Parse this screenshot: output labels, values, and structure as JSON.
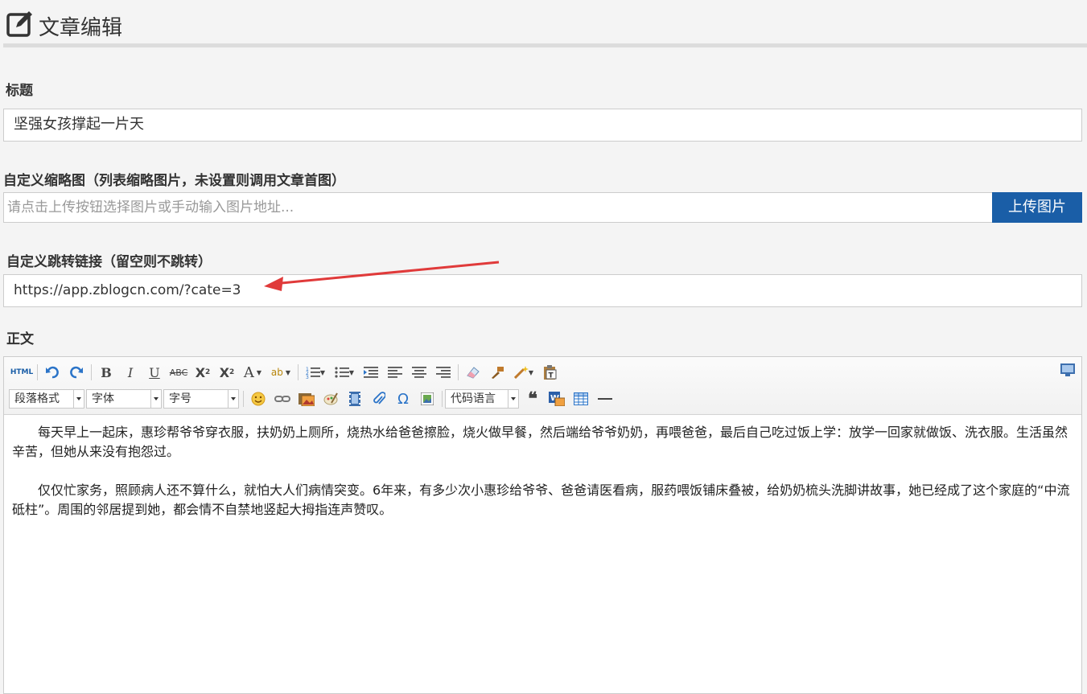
{
  "header": {
    "title": "文章编辑"
  },
  "fields": {
    "title_label": "标题",
    "title_value": "坚强女孩撑起一片天",
    "thumb_label": "自定义缩略图（列表缩略图片，未设置则调用文章首图）",
    "thumb_placeholder": "请点击上传按钮选择图片或手动输入图片地址...",
    "upload_label": "上传图片",
    "link_label": "自定义跳转链接（留空则不跳转）",
    "link_value": "https://app.zblogcn.com/?cate=3",
    "body_label": "正文"
  },
  "toolbar": {
    "html_label": "HTML",
    "paragraph_select": "段落格式",
    "font_select": "字体",
    "size_select": "字号",
    "code_select": "代码语言"
  },
  "content": {
    "paragraphs": [
      "每天早上一起床，惠珍帮爷爷穿衣服，扶奶奶上厕所，烧热水给爸爸擦脸，烧火做早餐，然后端给爷爷奶奶，再喂爸爸，最后自己吃过饭上学：放学一回家就做饭、洗衣服。生活虽然辛苦，但她从来没有抱怨过。",
      "仅仅忙家务，照顾病人还不算什么，就怕大人们病情突变。6年来，有多少次小惠珍给爷爷、爸爸请医看病，服药喂饭铺床叠被，给奶奶梳头洗脚讲故事，她已经成了这个家庭的“中流砥柱”。周围的邻居提到她，都会情不自禁地竖起大拇指连声赞叹。"
    ]
  },
  "colors": {
    "accent": "#1a5ea7",
    "arrow": "#e03a3a"
  }
}
